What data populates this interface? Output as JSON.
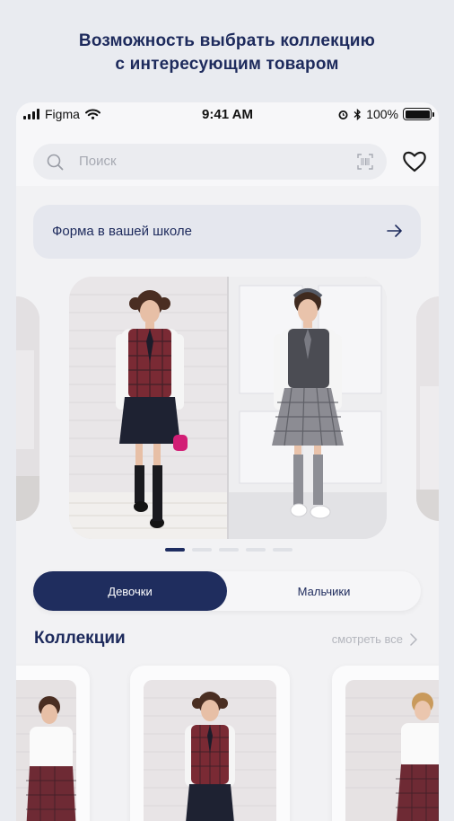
{
  "promo": {
    "line1": "Возможность  выбрать коллекцию",
    "line2": "с интересующим товаром"
  },
  "status_bar": {
    "carrier": "Figma",
    "time": "9:41 AM",
    "battery": "100%"
  },
  "search": {
    "placeholder": "Поиск"
  },
  "school_banner": {
    "label": "Форма в вашей школе"
  },
  "carousel": {
    "dots": 5,
    "active_index": 0
  },
  "gender_toggle": {
    "girls_label": "Девочки",
    "boys_label": "Мальчики",
    "selected": "girls"
  },
  "collections": {
    "title": "Коллекции",
    "see_all_label": "смотреть все"
  },
  "colors": {
    "accent": "#1f2d5e",
    "background": "#e9ebf0",
    "muted_text": "#b4b6bd"
  }
}
